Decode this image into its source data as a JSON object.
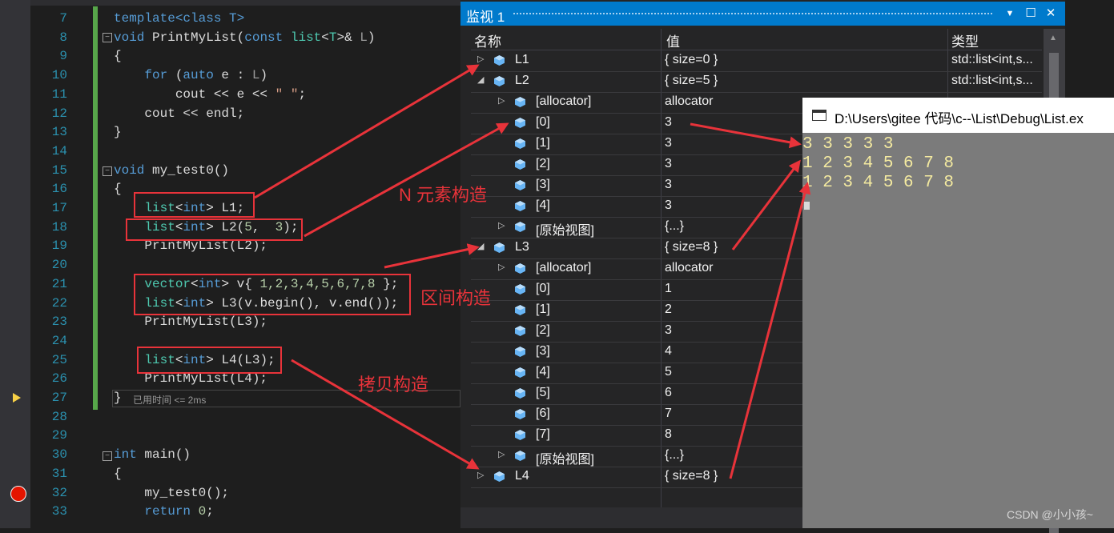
{
  "editor": {
    "line_numbers": [
      "7",
      "8",
      "9",
      "10",
      "11",
      "12",
      "13",
      "14",
      "15",
      "16",
      "17",
      "18",
      "19",
      "20",
      "21",
      "22",
      "23",
      "24",
      "25",
      "26",
      "27",
      "28",
      "29",
      "30",
      "31",
      "32",
      "33"
    ],
    "lines": [
      [
        {
          "t": "template<class T>",
          "c": "kw"
        }
      ],
      [
        {
          "t": "void",
          "c": "kw"
        },
        {
          "t": " PrintMyList(",
          "c": ""
        },
        {
          "t": "const",
          "c": "kw"
        },
        {
          "t": " ",
          "c": ""
        },
        {
          "t": "list",
          "c": "ty"
        },
        {
          "t": "<",
          "c": ""
        },
        {
          "t": "T",
          "c": "ty"
        },
        {
          "t": ">& ",
          "c": ""
        },
        {
          "t": "L",
          "c": "par"
        },
        {
          "t": ")",
          "c": ""
        }
      ],
      [
        {
          "t": "{",
          "c": ""
        }
      ],
      [
        {
          "t": "    ",
          "c": ""
        },
        {
          "t": "for",
          "c": "kw"
        },
        {
          "t": " (",
          "c": ""
        },
        {
          "t": "auto",
          "c": "kw"
        },
        {
          "t": " e : ",
          "c": ""
        },
        {
          "t": "L",
          "c": "par"
        },
        {
          "t": ")",
          "c": ""
        }
      ],
      [
        {
          "t": "        cout << e << ",
          "c": ""
        },
        {
          "t": "\" \"",
          "c": "str"
        },
        {
          "t": ";",
          "c": ""
        }
      ],
      [
        {
          "t": "    cout << endl;",
          "c": ""
        }
      ],
      [
        {
          "t": "}",
          "c": ""
        }
      ],
      [],
      [
        {
          "t": "void",
          "c": "kw"
        },
        {
          "t": " my_test0()",
          "c": ""
        }
      ],
      [
        {
          "t": "{",
          "c": ""
        }
      ],
      [
        {
          "t": "    ",
          "c": ""
        },
        {
          "t": "list",
          "c": "ty"
        },
        {
          "t": "<",
          "c": ""
        },
        {
          "t": "int",
          "c": "kw"
        },
        {
          "t": "> L1;",
          "c": ""
        }
      ],
      [
        {
          "t": "    ",
          "c": ""
        },
        {
          "t": "list",
          "c": "ty"
        },
        {
          "t": "<",
          "c": ""
        },
        {
          "t": "int",
          "c": "kw"
        },
        {
          "t": "> L2(",
          "c": ""
        },
        {
          "t": "5",
          "c": "num"
        },
        {
          "t": ",  ",
          "c": ""
        },
        {
          "t": "3",
          "c": "num"
        },
        {
          "t": ");",
          "c": ""
        }
      ],
      [
        {
          "t": "    PrintMyList(L2);",
          "c": ""
        }
      ],
      [],
      [
        {
          "t": "    ",
          "c": ""
        },
        {
          "t": "vector",
          "c": "ty"
        },
        {
          "t": "<",
          "c": ""
        },
        {
          "t": "int",
          "c": "kw"
        },
        {
          "t": "> v{ ",
          "c": ""
        },
        {
          "t": "1,2,3,4,5,6,7,8",
          "c": "num"
        },
        {
          "t": " };",
          "c": ""
        }
      ],
      [
        {
          "t": "    ",
          "c": ""
        },
        {
          "t": "list",
          "c": "ty"
        },
        {
          "t": "<",
          "c": ""
        },
        {
          "t": "int",
          "c": "kw"
        },
        {
          "t": "> L3(v.begin(), v.end());",
          "c": ""
        }
      ],
      [
        {
          "t": "    PrintMyList(L3);",
          "c": ""
        }
      ],
      [],
      [
        {
          "t": "    ",
          "c": ""
        },
        {
          "t": "list",
          "c": "ty"
        },
        {
          "t": "<",
          "c": ""
        },
        {
          "t": "int",
          "c": "kw"
        },
        {
          "t": "> L4(L3);",
          "c": ""
        }
      ],
      [
        {
          "t": "    PrintMyList(L4);",
          "c": ""
        }
      ],
      [
        {
          "t": "}",
          "c": ""
        }
      ],
      [],
      [],
      [
        {
          "t": "int",
          "c": "kw"
        },
        {
          "t": " main()",
          "c": ""
        }
      ],
      [
        {
          "t": "{",
          "c": ""
        }
      ],
      [
        {
          "t": "    my_test0();",
          "c": ""
        }
      ],
      [
        {
          "t": "    ",
          "c": ""
        },
        {
          "t": "return",
          "c": "kw"
        },
        {
          "t": " ",
          "c": ""
        },
        {
          "t": "0",
          "c": "num"
        },
        {
          "t": ";",
          "c": ""
        }
      ]
    ],
    "elapsed_hint": "已用时间 <= 2ms",
    "current_line_icon": "arrow-right-icon",
    "breakpoint_icon": "breakpoint-icon"
  },
  "watch": {
    "title": "监视 1",
    "headers": {
      "name": "名称",
      "value": "值",
      "type": "类型"
    },
    "rows": [
      {
        "exp": "▷",
        "depth": 0,
        "name": "L1",
        "value": "{ size=0 }",
        "type": "std::list<int,s..."
      },
      {
        "exp": "◢",
        "depth": 0,
        "name": "L2",
        "value": "{ size=5 }",
        "type": "std::list<int,s..."
      },
      {
        "exp": "▷",
        "depth": 1,
        "name": "[allocator]",
        "value": "allocator",
        "type": ""
      },
      {
        "exp": "",
        "depth": 1,
        "name": "[0]",
        "value": "3",
        "type": ""
      },
      {
        "exp": "",
        "depth": 1,
        "name": "[1]",
        "value": "3",
        "type": ""
      },
      {
        "exp": "",
        "depth": 1,
        "name": "[2]",
        "value": "3",
        "type": ""
      },
      {
        "exp": "",
        "depth": 1,
        "name": "[3]",
        "value": "3",
        "type": ""
      },
      {
        "exp": "",
        "depth": 1,
        "name": "[4]",
        "value": "3",
        "type": ""
      },
      {
        "exp": "▷",
        "depth": 1,
        "name": "[原始视图]",
        "value": "{...}",
        "type": ""
      },
      {
        "exp": "◢",
        "depth": 0,
        "name": "L3",
        "value": "{ size=8 }",
        "type": ""
      },
      {
        "exp": "▷",
        "depth": 1,
        "name": "[allocator]",
        "value": "allocator",
        "type": ""
      },
      {
        "exp": "",
        "depth": 1,
        "name": "[0]",
        "value": "1",
        "type": ""
      },
      {
        "exp": "",
        "depth": 1,
        "name": "[1]",
        "value": "2",
        "type": ""
      },
      {
        "exp": "",
        "depth": 1,
        "name": "[2]",
        "value": "3",
        "type": ""
      },
      {
        "exp": "",
        "depth": 1,
        "name": "[3]",
        "value": "4",
        "type": ""
      },
      {
        "exp": "",
        "depth": 1,
        "name": "[4]",
        "value": "5",
        "type": ""
      },
      {
        "exp": "",
        "depth": 1,
        "name": "[5]",
        "value": "6",
        "type": ""
      },
      {
        "exp": "",
        "depth": 1,
        "name": "[6]",
        "value": "7",
        "type": ""
      },
      {
        "exp": "",
        "depth": 1,
        "name": "[7]",
        "value": "8",
        "type": ""
      },
      {
        "exp": "▷",
        "depth": 1,
        "name": "[原始视图]",
        "value": "{...}",
        "type": ""
      },
      {
        "exp": "▷",
        "depth": 0,
        "name": "L4",
        "value": "{ size=8 }",
        "type": ""
      },
      {
        "exp": "",
        "depth": 0,
        "name": "",
        "value": "",
        "type": ""
      }
    ],
    "buttons": {
      "dropdown": "▼",
      "maximize": "☐",
      "close": "✕"
    }
  },
  "console": {
    "title": "D:\\Users\\gitee 代码\\c--\\List\\Debug\\List.ex",
    "lines": [
      "3 3 3 3 3",
      "1 2 3 4 5 6 7 8",
      "1 2 3 4 5 6 7 8"
    ]
  },
  "annotations": {
    "fill_ctor": "N 元素构造",
    "range_ctor": "区间构造",
    "copy_ctor": "拷贝构造"
  },
  "watermark": "CSDN @小小孩~",
  "colors": {
    "accent": "#007acc",
    "annotation": "#e8333a",
    "console_text": "#f4eaa0"
  }
}
